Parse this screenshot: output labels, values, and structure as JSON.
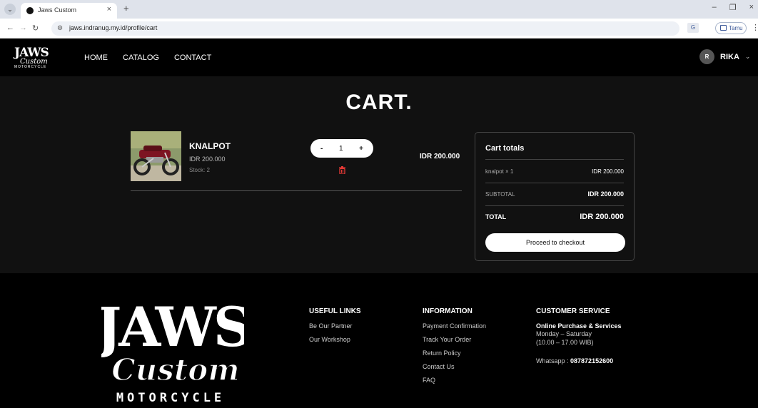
{
  "browser": {
    "tab_title": "Jaws Custom",
    "url": "jaws.indranug.my.id/profile/cart",
    "profile_label": "Tamu"
  },
  "header": {
    "logo_top": "JAWS",
    "logo_mid": "Custom",
    "logo_bottom": "MOTORCYCLE",
    "nav": [
      "HOME",
      "CATALOG",
      "CONTACT"
    ],
    "user_initial": "R",
    "user_name": "RIKA"
  },
  "page": {
    "title": "CART."
  },
  "cart_item": {
    "name": "KNALPOT",
    "price": "IDR 200.000",
    "stock": "Stock: 2",
    "quantity": "1",
    "minus": "-",
    "plus": "+",
    "line_total": "IDR 200.000"
  },
  "totals": {
    "title": "Cart totals",
    "item_line": "knalpot × 1",
    "item_amount": "IDR 200.000",
    "subtotal_label": "SUBTOTAL",
    "subtotal_value": "IDR 200.000",
    "total_label": "TOTAL",
    "total_value": "IDR 200.000",
    "checkout_label": "Proceed to checkout"
  },
  "footer": {
    "logo_top": "JAWS",
    "logo_mid": "Custom",
    "logo_bottom": "MOTORCYCLE",
    "useful_links": {
      "title": "USEFUL LINKS",
      "links": [
        "Be Our Partner",
        "Our Workshop"
      ]
    },
    "information": {
      "title": "INFORMATION",
      "links": [
        "Payment Confirmation",
        "Track Your Order",
        "Return Policy",
        "Contact Us",
        "FAQ"
      ]
    },
    "customer_service": {
      "title": "CUSTOMER SERVICE",
      "subtitle": "Online Purchase & Services",
      "days": "Monday – Saturday",
      "hours": "(10.00 – 17.00 WIB)",
      "whatsapp_label": "Whatsapp : ",
      "whatsapp_number": "087872152600"
    }
  },
  "colors": {
    "header_bg": "#000000",
    "main_bg": "#111111",
    "accent_delete": "#e53935",
    "text_primary": "#ffffff"
  }
}
